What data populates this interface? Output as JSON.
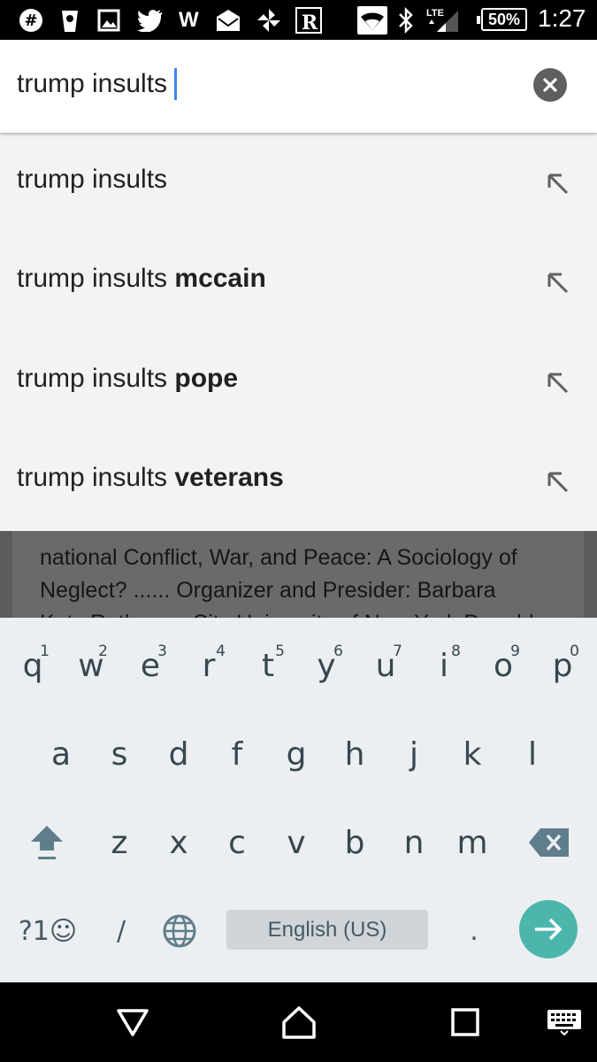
{
  "status_bar": {
    "icons": [
      "slack-icon",
      "cup-icon",
      "image-icon",
      "twitter-icon",
      "wikipedia-icon",
      "mail-icon",
      "pinwheel-icon",
      "reader-icon",
      "wifi-icon",
      "bluetooth-icon",
      "lte-signal-icon"
    ],
    "w_label": "W",
    "r_label": "R",
    "lte_label": "LTE",
    "battery": "50%",
    "time": "1:27"
  },
  "search": {
    "query": "trump insults",
    "cursor_color": "#4285f4"
  },
  "suggestions": [
    {
      "prefix": "trump insults",
      "suffix": ""
    },
    {
      "prefix": "trump insults ",
      "suffix": "mccain"
    },
    {
      "prefix": "trump insults ",
      "suffix": "pope"
    },
    {
      "prefix": "trump insults ",
      "suffix": "veterans"
    }
  ],
  "background_page": {
    "lines": [
      "national Conflict, War, and Peace: A Sociology of",
      "Neglect? ...... Organizer and Presider: Barbara",
      "Katz Rothman, City University of New York Donald"
    ]
  },
  "keyboard": {
    "row1": [
      {
        "key": "q",
        "hint": "1"
      },
      {
        "key": "w",
        "hint": "2"
      },
      {
        "key": "e",
        "hint": "3"
      },
      {
        "key": "r",
        "hint": "4"
      },
      {
        "key": "t",
        "hint": "5"
      },
      {
        "key": "y",
        "hint": "6"
      },
      {
        "key": "u",
        "hint": "7"
      },
      {
        "key": "i",
        "hint": "8"
      },
      {
        "key": "o",
        "hint": "9"
      },
      {
        "key": "p",
        "hint": "0"
      }
    ],
    "row2": [
      "a",
      "s",
      "d",
      "f",
      "g",
      "h",
      "j",
      "k",
      "l"
    ],
    "row3": [
      "z",
      "x",
      "c",
      "v",
      "b",
      "n",
      "m"
    ],
    "symbols_label": "?1☺",
    "slash_label": "/",
    "space_label": "English (US)",
    "period_label": ".",
    "accent_color": "#4db6ac"
  },
  "nav_bar": {
    "buttons": [
      "back-icon",
      "home-icon",
      "recents-icon",
      "keyboard-switch-icon"
    ]
  }
}
